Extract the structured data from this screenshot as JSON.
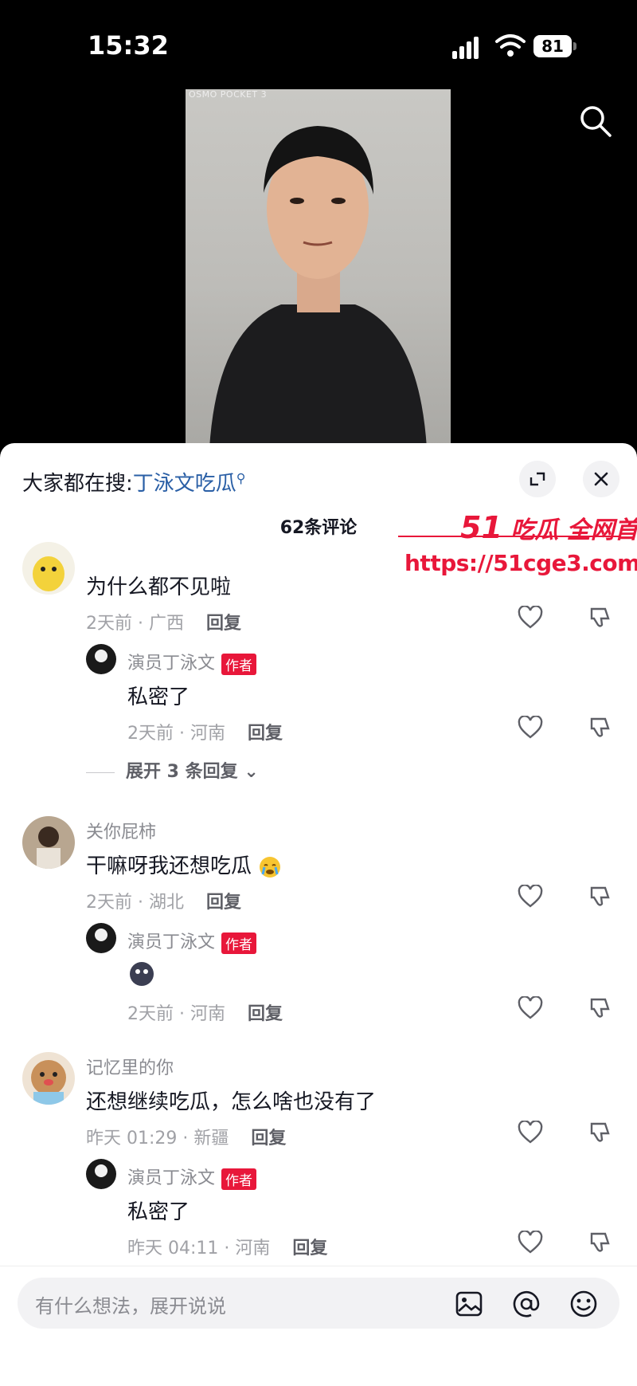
{
  "status_bar": {
    "time": "15:32",
    "battery": "81"
  },
  "video": {
    "camera_label": "OSMO POCKET 3"
  },
  "sheet": {
    "trending_prefix": "大家都在搜:",
    "trending_keyword": "丁泳文吃瓜",
    "comment_count": "62条评论"
  },
  "watermark": {
    "title_num": "51",
    "title_text": "吃瓜 全网首发",
    "url": "https://51cge3.com"
  },
  "comments": [
    {
      "text": "为什么都不见啦",
      "meta": "2天前 · 广西",
      "reply_label": "回复",
      "reply": {
        "user": "演员丁泳文",
        "tag": "作者",
        "text": "私密了",
        "meta": "2天前 · 河南",
        "reply_label": "回复"
      },
      "expand": "展开 3 条回复"
    },
    {
      "user": "关你屁柿",
      "text": "干嘛呀我还想吃瓜",
      "meta": "2天前 · 湖北",
      "reply_label": "回复",
      "reply": {
        "user": "演员丁泳文",
        "tag": "作者",
        "meta": "2天前 · 河南",
        "reply_label": "回复"
      }
    },
    {
      "user": "记忆里的你",
      "text": "还想继续吃瓜，怎么啥也没有了",
      "meta": "昨天 01:29 · 新疆",
      "reply_label": "回复",
      "reply": {
        "user": "演员丁泳文",
        "tag": "作者",
        "text": "私密了",
        "meta": "昨天 04:11 · 河南",
        "reply_label": "回复"
      }
    }
  ],
  "input": {
    "placeholder": "有什么想法，展开说说"
  },
  "colors": {
    "accent": "#e8173a",
    "link": "#2a5fa6"
  },
  "icons": [
    "search-icon",
    "fullscreen-icon",
    "close-icon",
    "heart-icon",
    "dislike-icon",
    "image-icon",
    "at-icon",
    "emoji-icon"
  ]
}
